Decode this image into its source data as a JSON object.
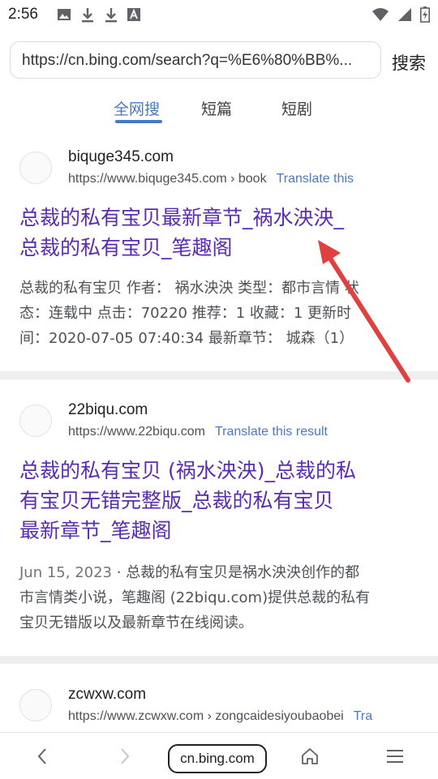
{
  "status_bar": {
    "time": "2:56",
    "icons": [
      "image-icon",
      "download-icon",
      "download-icon",
      "font-icon"
    ],
    "right_icons": [
      "wifi-icon",
      "signal-icon",
      "battery-charging-icon"
    ]
  },
  "search": {
    "url": "https://cn.bing.com/search?q=%E6%80%BB%...",
    "button_label": "搜索"
  },
  "tabs": [
    {
      "label": "全网搜",
      "active": true
    },
    {
      "label": "短篇",
      "active": false
    },
    {
      "label": "短剧",
      "active": false
    }
  ],
  "results": [
    {
      "site_name": "biquge345.com",
      "url": "https://www.biquge345.com › book",
      "translate": "Translate this",
      "title_lines": [
        "总裁的私有宝贝最新章节_祸水泱泱_",
        "总裁的私有宝贝_笔趣阁"
      ],
      "snippet_lines": [
        "总裁的私有宝贝 作者： 祸水泱泱 类型：都市言情 状",
        "态：连载中 点击：70220 推荐：1 收藏：1 更新时",
        "间：2020-07-05 07:40:34 最新章节： 城森（1）"
      ]
    },
    {
      "site_name": "22biqu.com",
      "url": "https://www.22biqu.com",
      "translate": "Translate this result",
      "title_lines": [
        "总裁的私有宝贝 (祸水泱泱)_总裁的私",
        "有宝贝无错完整版_总裁的私有宝贝",
        "最新章节_笔趣阁"
      ],
      "date": "Jun 15, 2023",
      "snippet_lines": [
        "总裁的私有宝贝是祸水泱泱创作的都",
        "市言情类小说，笔趣阁 (22biqu.com)提供总裁的私有",
        "宝贝无错版以及最新章节在线阅读。"
      ]
    },
    {
      "site_name": "zcwxw.com",
      "url": "https://www.zcwxw.com › zongcaidesiyoubaobei",
      "translate": "Tra"
    }
  ],
  "bottom_nav": {
    "domain": "cn.bing.com",
    "icons": [
      "back-icon",
      "forward-icon",
      "home-icon",
      "menu-icon"
    ]
  },
  "colors": {
    "link_title": "#5a2db0",
    "accent": "#4a78c9",
    "annotation_arrow": "#e04040"
  }
}
